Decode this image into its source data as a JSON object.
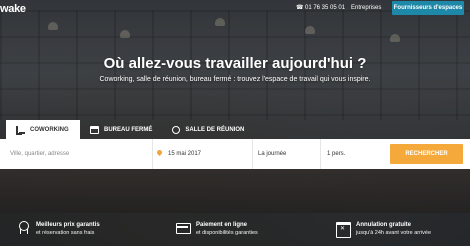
{
  "topbar": {
    "logo": "wake",
    "phone": "01 76 35 05 01",
    "entreprises": "Entreprises",
    "fournisseurs": "Fournisseurs d'espaces"
  },
  "hero": {
    "title": "Où allez-vous travailler aujourd'hui ?",
    "subtitle": "Coworking, salle de réunion, bureau fermé : trouvez l'espace de travail qui vous inspire."
  },
  "tabs": [
    {
      "label": "COWORKING",
      "icon": "desk-chair-icon",
      "active": true
    },
    {
      "label": "BUREAU FERMÉ",
      "icon": "office-icon",
      "active": false
    },
    {
      "label": "SALLE DE RÉUNION",
      "icon": "meeting-room-icon",
      "active": false
    }
  ],
  "search": {
    "location_placeholder": "Ville, quartier, adresse",
    "date": "15 mai 2017",
    "duration": "La journée",
    "persons": "1 pers.",
    "button": "RECHERCHER"
  },
  "benefits": [
    {
      "title": "Meilleurs prix garantis",
      "subtitle": "et réservation sans frais",
      "icon": "medal-icon"
    },
    {
      "title": "Paiement en ligne",
      "subtitle": "et disponibilités garanties",
      "icon": "credit-card-icon"
    },
    {
      "title": "Annulation gratuite",
      "subtitle": "jusqu'à 24h avant votre arrivée",
      "icon": "calendar-cancel-icon"
    }
  ],
  "colors": {
    "accent": "#f6a93b",
    "brand_blue": "#1e88a8"
  }
}
